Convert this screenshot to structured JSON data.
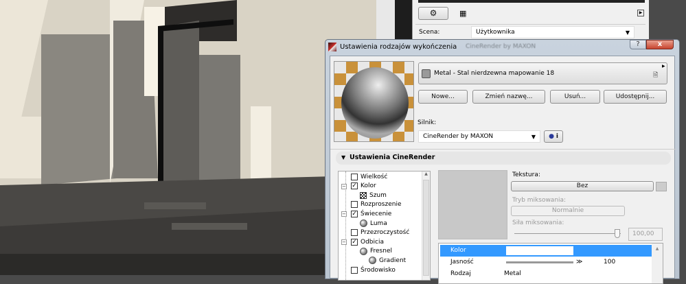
{
  "background_panel": {
    "scene_label": "Scena:",
    "scene_value": "Użytkownika",
    "blurred_engine": "CineRender by MAXON"
  },
  "dialog": {
    "title": "Ustawienia rodzajów wykończenia",
    "help_label": "?",
    "close_label": "x",
    "material_name": "Metal - Stal nierdzewna mapowanie 18",
    "buttons": {
      "new": "Nowe...",
      "rename": "Zmień nazwę...",
      "delete": "Usuń...",
      "share": "Udostępnij..."
    },
    "engine_label": "Silnik:",
    "engine_value": "CineRender by MAXON",
    "engine_info": "i",
    "section_title": "Ustawienia CineRender",
    "tree": [
      {
        "label": "Wielkość",
        "type": "size"
      },
      {
        "label": "Kolor",
        "type": "checkbox",
        "checked": true
      },
      {
        "label": "Szum",
        "type": "noise"
      },
      {
        "label": "Rozproszenie",
        "type": "checkbox",
        "checked": false
      },
      {
        "label": "Świecenie",
        "type": "checkbox",
        "checked": true
      },
      {
        "label": "Luma",
        "type": "ball"
      },
      {
        "label": "Przezroczystość",
        "type": "checkbox",
        "checked": false
      },
      {
        "label": "Odbicia",
        "type": "checkbox",
        "checked": true
      },
      {
        "label": "Fresnel",
        "type": "ball"
      },
      {
        "label": "Gradient",
        "type": "ball"
      },
      {
        "label": "Środowisko",
        "type": "checkbox",
        "checked": false
      }
    ],
    "texture_label": "Tekstura:",
    "texture_value": "Bez",
    "blend_mode_label": "Tryb miksowania:",
    "blend_mode_value": "Normalnie",
    "blend_strength_label": "Siła miksowania:",
    "blend_strength_value": "100,00",
    "blend_strength_fraction": 1.0,
    "properties": [
      {
        "name": "Kolor",
        "value": "",
        "color": "#ffffff"
      },
      {
        "name": "Jasność",
        "value": "100"
      },
      {
        "name": "Rodzaj",
        "value": "Metal"
      }
    ],
    "colors": {
      "selection": "#3399ff"
    }
  }
}
